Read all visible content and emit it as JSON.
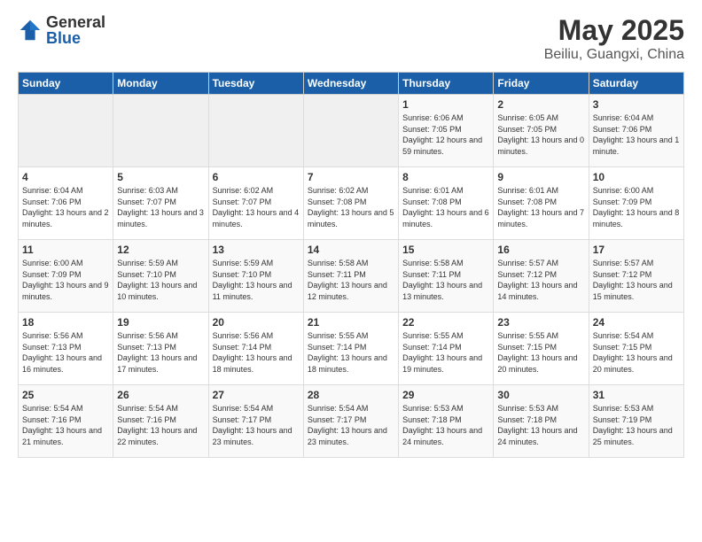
{
  "header": {
    "logo_general": "General",
    "logo_blue": "Blue",
    "month": "May 2025",
    "location": "Beiliu, Guangxi, China"
  },
  "days_of_week": [
    "Sunday",
    "Monday",
    "Tuesday",
    "Wednesday",
    "Thursday",
    "Friday",
    "Saturday"
  ],
  "weeks": [
    [
      {
        "day": "",
        "empty": true
      },
      {
        "day": "",
        "empty": true
      },
      {
        "day": "",
        "empty": true
      },
      {
        "day": "",
        "empty": true
      },
      {
        "day": "1",
        "sunrise": "6:06 AM",
        "sunset": "7:05 PM",
        "daylight": "12 hours and 59 minutes."
      },
      {
        "day": "2",
        "sunrise": "6:05 AM",
        "sunset": "7:05 PM",
        "daylight": "13 hours and 0 minutes."
      },
      {
        "day": "3",
        "sunrise": "6:04 AM",
        "sunset": "7:06 PM",
        "daylight": "13 hours and 1 minute."
      }
    ],
    [
      {
        "day": "4",
        "sunrise": "6:04 AM",
        "sunset": "7:06 PM",
        "daylight": "13 hours and 2 minutes."
      },
      {
        "day": "5",
        "sunrise": "6:03 AM",
        "sunset": "7:07 PM",
        "daylight": "13 hours and 3 minutes."
      },
      {
        "day": "6",
        "sunrise": "6:02 AM",
        "sunset": "7:07 PM",
        "daylight": "13 hours and 4 minutes."
      },
      {
        "day": "7",
        "sunrise": "6:02 AM",
        "sunset": "7:08 PM",
        "daylight": "13 hours and 5 minutes."
      },
      {
        "day": "8",
        "sunrise": "6:01 AM",
        "sunset": "7:08 PM",
        "daylight": "13 hours and 6 minutes."
      },
      {
        "day": "9",
        "sunrise": "6:01 AM",
        "sunset": "7:08 PM",
        "daylight": "13 hours and 7 minutes."
      },
      {
        "day": "10",
        "sunrise": "6:00 AM",
        "sunset": "7:09 PM",
        "daylight": "13 hours and 8 minutes."
      }
    ],
    [
      {
        "day": "11",
        "sunrise": "6:00 AM",
        "sunset": "7:09 PM",
        "daylight": "13 hours and 9 minutes."
      },
      {
        "day": "12",
        "sunrise": "5:59 AM",
        "sunset": "7:10 PM",
        "daylight": "13 hours and 10 minutes."
      },
      {
        "day": "13",
        "sunrise": "5:59 AM",
        "sunset": "7:10 PM",
        "daylight": "13 hours and 11 minutes."
      },
      {
        "day": "14",
        "sunrise": "5:58 AM",
        "sunset": "7:11 PM",
        "daylight": "13 hours and 12 minutes."
      },
      {
        "day": "15",
        "sunrise": "5:58 AM",
        "sunset": "7:11 PM",
        "daylight": "13 hours and 13 minutes."
      },
      {
        "day": "16",
        "sunrise": "5:57 AM",
        "sunset": "7:12 PM",
        "daylight": "13 hours and 14 minutes."
      },
      {
        "day": "17",
        "sunrise": "5:57 AM",
        "sunset": "7:12 PM",
        "daylight": "13 hours and 15 minutes."
      }
    ],
    [
      {
        "day": "18",
        "sunrise": "5:56 AM",
        "sunset": "7:13 PM",
        "daylight": "13 hours and 16 minutes."
      },
      {
        "day": "19",
        "sunrise": "5:56 AM",
        "sunset": "7:13 PM",
        "daylight": "13 hours and 17 minutes."
      },
      {
        "day": "20",
        "sunrise": "5:56 AM",
        "sunset": "7:14 PM",
        "daylight": "13 hours and 18 minutes."
      },
      {
        "day": "21",
        "sunrise": "5:55 AM",
        "sunset": "7:14 PM",
        "daylight": "13 hours and 18 minutes."
      },
      {
        "day": "22",
        "sunrise": "5:55 AM",
        "sunset": "7:14 PM",
        "daylight": "13 hours and 19 minutes."
      },
      {
        "day": "23",
        "sunrise": "5:55 AM",
        "sunset": "7:15 PM",
        "daylight": "13 hours and 20 minutes."
      },
      {
        "day": "24",
        "sunrise": "5:54 AM",
        "sunset": "7:15 PM",
        "daylight": "13 hours and 20 minutes."
      }
    ],
    [
      {
        "day": "25",
        "sunrise": "5:54 AM",
        "sunset": "7:16 PM",
        "daylight": "13 hours and 21 minutes."
      },
      {
        "day": "26",
        "sunrise": "5:54 AM",
        "sunset": "7:16 PM",
        "daylight": "13 hours and 22 minutes."
      },
      {
        "day": "27",
        "sunrise": "5:54 AM",
        "sunset": "7:17 PM",
        "daylight": "13 hours and 23 minutes."
      },
      {
        "day": "28",
        "sunrise": "5:54 AM",
        "sunset": "7:17 PM",
        "daylight": "13 hours and 23 minutes."
      },
      {
        "day": "29",
        "sunrise": "5:53 AM",
        "sunset": "7:18 PM",
        "daylight": "13 hours and 24 minutes."
      },
      {
        "day": "30",
        "sunrise": "5:53 AM",
        "sunset": "7:18 PM",
        "daylight": "13 hours and 24 minutes."
      },
      {
        "day": "31",
        "sunrise": "5:53 AM",
        "sunset": "7:19 PM",
        "daylight": "13 hours and 25 minutes."
      }
    ]
  ]
}
